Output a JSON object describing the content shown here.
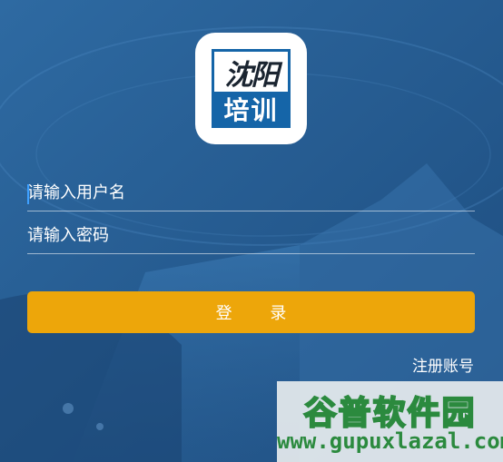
{
  "logo": {
    "top_text": "沈阳",
    "bottom_text": "培训"
  },
  "form": {
    "username_placeholder": "请输入用户名",
    "password_placeholder": "请输入密码",
    "login_label": "登 录",
    "register_label": "注册账号"
  },
  "watermark": {
    "title": "谷普软件园",
    "url": "www.gupuxlazal.com"
  },
  "colors": {
    "background": "#255789",
    "login_button": "#eda60a",
    "logo_blue": "#1565a8",
    "watermark_green": "#2b8a3e"
  }
}
